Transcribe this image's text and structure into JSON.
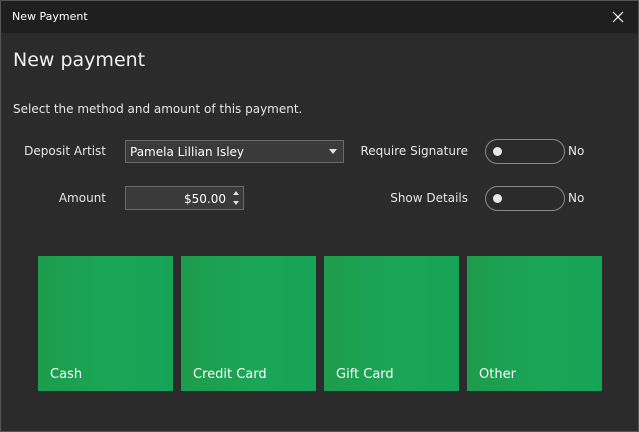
{
  "window": {
    "title": "New Payment",
    "close_icon": "close-icon"
  },
  "form": {
    "heading": "New payment",
    "instructions": "Select the method and amount of this payment.",
    "deposit_artist": {
      "label": "Deposit Artist",
      "value": "Pamela Lillian Isley"
    },
    "amount": {
      "label": "Amount",
      "value": "$50.00"
    },
    "require_signature": {
      "label": "Require Signature",
      "state": "No",
      "on": false
    },
    "show_details": {
      "label": "Show Details",
      "state": "No",
      "on": false
    }
  },
  "methods": [
    {
      "label": "Cash"
    },
    {
      "label": "Credit Card"
    },
    {
      "label": "Gift Card"
    },
    {
      "label": "Other"
    }
  ],
  "colors": {
    "background": "#2b2b2b",
    "titlebar": "#1f1f1f",
    "tile": "#1aa656",
    "text": "#ffffff"
  }
}
